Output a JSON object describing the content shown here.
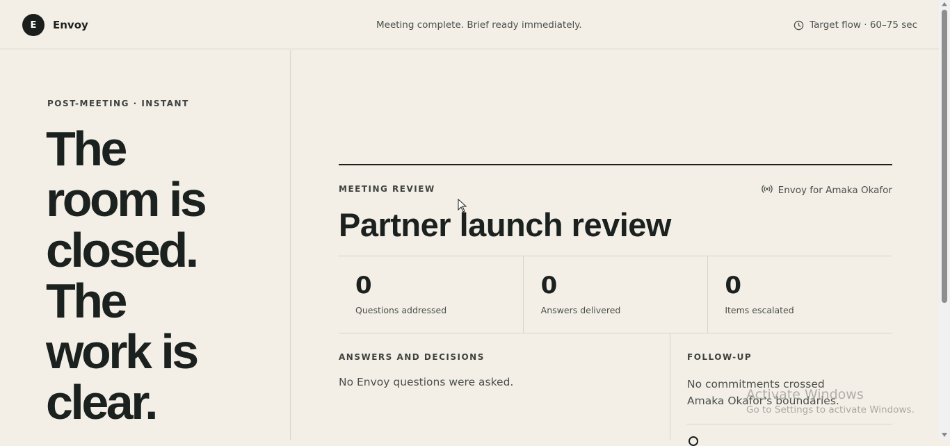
{
  "header": {
    "logo_letter": "E",
    "app_name": "Envoy",
    "status_message": "Meeting complete. Brief ready immediately.",
    "target_flow": "Target flow · 60–75 sec",
    "clock_icon": "clock-icon"
  },
  "hero": {
    "eyebrow": "POST-MEETING · INSTANT",
    "headline_lines": [
      "The",
      "room is",
      "closed.",
      "The",
      "work is",
      "clear."
    ]
  },
  "review": {
    "section_label": "MEETING REVIEW",
    "envoy_for": "Envoy for Amaka Okafor",
    "broadcast_icon": "broadcast-icon",
    "title": "Partner launch review",
    "stats": [
      {
        "value": "0",
        "label": "Questions addressed"
      },
      {
        "value": "0",
        "label": "Answers delivered"
      },
      {
        "value": "0",
        "label": "Items escalated"
      }
    ],
    "answers": {
      "label": "ANSWERS AND DECISIONS",
      "text": "No Envoy questions were asked."
    },
    "follow_up": {
      "label": "FOLLOW-UP",
      "text": "No commitments crossed Amaka Okafor's boundaries."
    }
  },
  "watermark": {
    "title": "Activate Windows",
    "subtitle": "Go to Settings to activate Windows."
  },
  "colors": {
    "background": "#f4efe6",
    "ink": "#1b1f1d",
    "muted": "#4a4f4c",
    "rule": "#d9d3c8"
  }
}
